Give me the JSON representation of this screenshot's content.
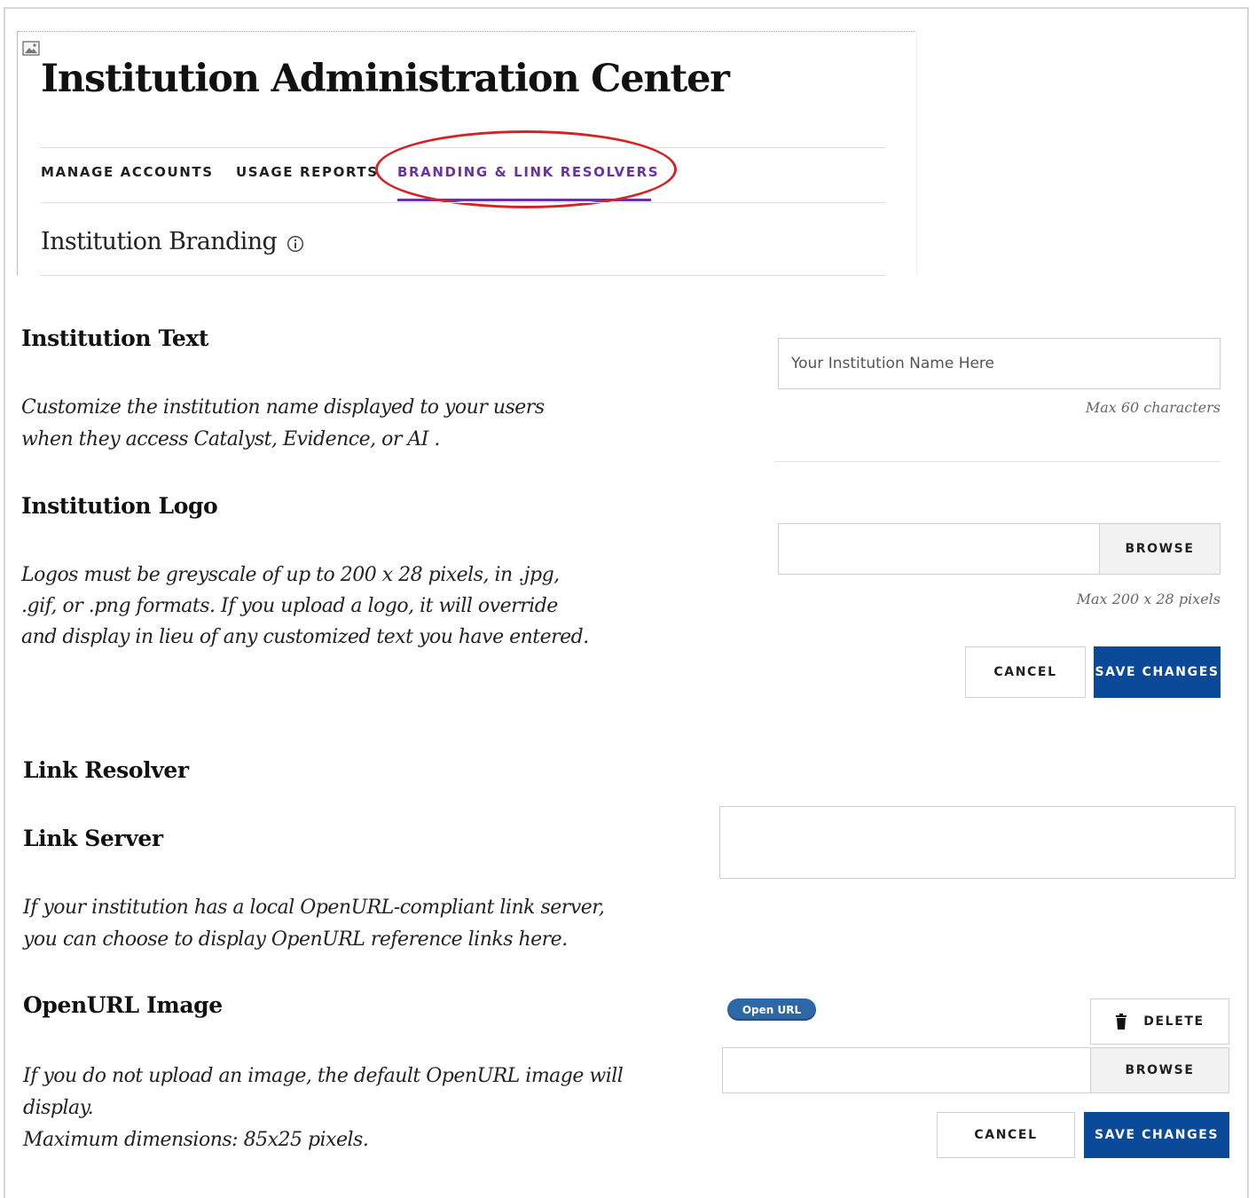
{
  "header": {
    "title": "Institution Administration Center",
    "tabs": [
      {
        "label": "MANAGE ACCOUNTS",
        "active": false
      },
      {
        "label": "USAGE REPORTS",
        "active": false
      },
      {
        "label": "BRANDING & LINK RESOLVERS",
        "active": true
      }
    ],
    "section_title": "Institution Branding"
  },
  "institution_text": {
    "heading": "Institution Text",
    "description_lines": [
      "Customize the institution name displayed to your users",
      "when they access Catalyst, Evidence, or AI ."
    ],
    "input_placeholder": "Your Institution Name Here",
    "input_value": "",
    "hint": "Max 60 characters"
  },
  "institution_logo": {
    "heading": "Institution Logo",
    "description_lines": [
      "Logos must be greyscale of up to 200 x 28 pixels, in .jpg,",
      ".gif, or .png formats. If you upload a logo, it will override",
      "and display in lieu of any customized text you have entered."
    ],
    "browse_label": "BROWSE",
    "hint": "Max 200 x 28 pixels",
    "cancel_label": "CANCEL",
    "save_label": "SAVE CHANGES"
  },
  "link_resolver": {
    "heading": "Link Resolver",
    "link_server": {
      "heading": "Link Server",
      "description_lines": [
        "If your institution has a local OpenURL-compliant link server,",
        "you can choose to display OpenURL reference links here."
      ],
      "input_value": ""
    },
    "openurl_image": {
      "heading": "OpenURL Image",
      "description_lines": [
        "If you do not upload an image, the default OpenURL image will",
        "display.",
        "Maximum dimensions: 85x25 pixels."
      ],
      "badge_label": "Open URL",
      "delete_label": "DELETE",
      "browse_label": "BROWSE",
      "cancel_label": "CANCEL",
      "save_label": "SAVE CHANGES"
    }
  },
  "colors": {
    "accent_purple": "#6a33a0",
    "primary_blue": "#0b4a99",
    "annotation_red": "#d42323"
  },
  "icons": [
    "broken-image-icon",
    "info-icon",
    "trash-icon"
  ]
}
